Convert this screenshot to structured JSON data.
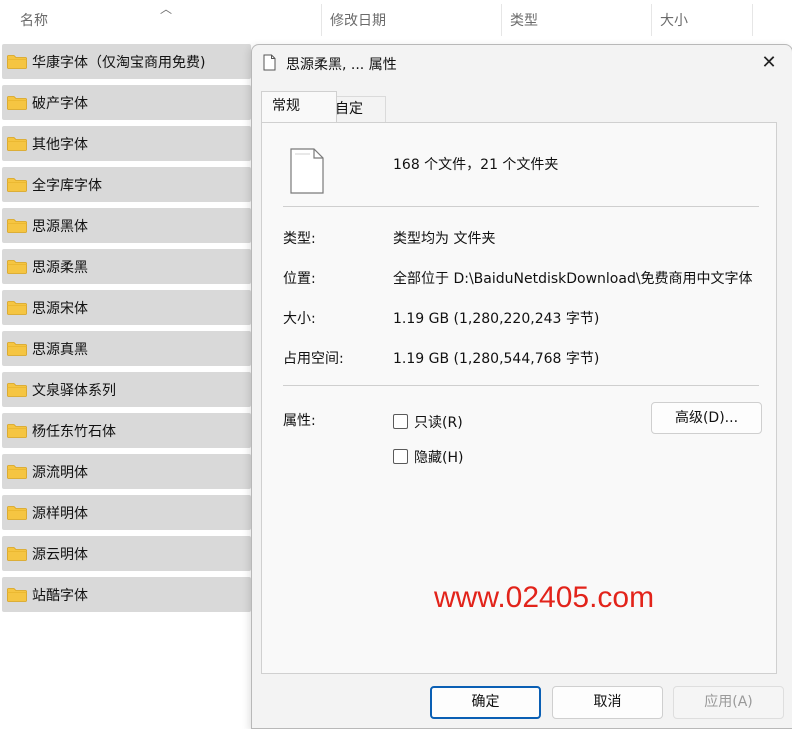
{
  "columns": {
    "name": "名称",
    "modified": "修改日期",
    "type": "类型",
    "size": "大小"
  },
  "folders": [
    "华康字体（仅淘宝商用免费)",
    "破产字体",
    "其他字体",
    "全字库字体",
    "思源黑体",
    "思源柔黑",
    "思源宋体",
    "思源真黑",
    "文泉驿体系列",
    "杨任东竹石体",
    "源流明体",
    "源样明体",
    "源云明体",
    "站酷字体"
  ],
  "dialog": {
    "title": "思源柔黑, ... 属性",
    "close_icon": "✕",
    "tabs": [
      "常规",
      "自定义"
    ],
    "summary": "168 个文件，21 个文件夹",
    "props": {
      "type_label": "类型:",
      "type_value": "类型均为 文件夹",
      "location_label": "位置:",
      "location_value": "全部位于 D:\\BaiduNetdiskDownload\\免费商用中文字体",
      "size_label": "大小:",
      "size_value": "1.19 GB (1,280,220,243 字节)",
      "disk_label": "占用空间:",
      "disk_value": "1.19 GB (1,280,544,768 字节)",
      "attr_label": "属性:",
      "readonly": "只读(R)",
      "hidden": "隐藏(H)",
      "advanced": "高级(D)..."
    },
    "watermark": "www.02405.com",
    "buttons": {
      "ok": "确定",
      "cancel": "取消",
      "apply": "应用(A)"
    }
  },
  "colors": {
    "row_bg": "#d9d9d9",
    "folder_yellow": "#f5c542",
    "watermark_red": "#e2231a",
    "primary_border": "#0a5fb4"
  },
  "icons": {
    "sort": "chevron-up-icon",
    "folder": "folder-icon",
    "file": "file-icon",
    "close": "close-icon"
  }
}
